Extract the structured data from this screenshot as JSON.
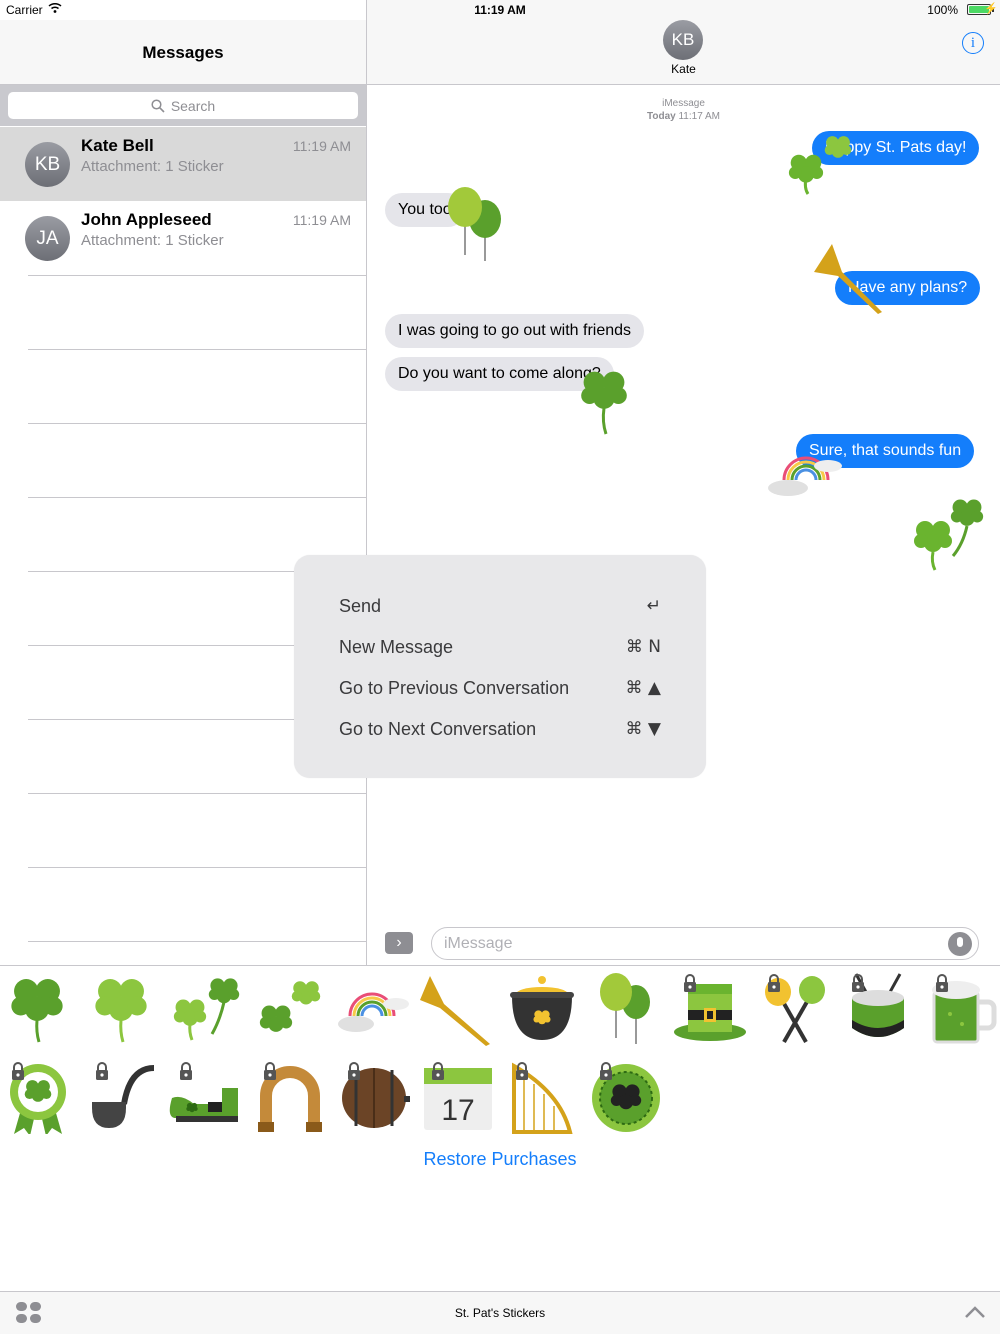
{
  "status_bar": {
    "carrier": "Carrier",
    "time": "11:19 AM",
    "battery": "100%"
  },
  "sidebar": {
    "title": "Messages",
    "search_placeholder": "Search",
    "conversations": [
      {
        "initials": "KB",
        "name": "Kate Bell",
        "preview": "Attachment: 1 Sticker",
        "time": "11:19 AM",
        "selected": true
      },
      {
        "initials": "JA",
        "name": "John Appleseed",
        "preview": "Attachment: 1 Sticker",
        "time": "11:19 AM",
        "selected": false
      }
    ]
  },
  "conversation": {
    "contact_initials": "KB",
    "contact_name": "Kate",
    "service": "iMessage",
    "day": "Today",
    "time": "11:17 AM",
    "messages": [
      {
        "direction": "out",
        "text": "Happy St. Pats day!"
      },
      {
        "direction": "in",
        "text": "You too"
      },
      {
        "direction": "out",
        "text": "Have any plans?"
      },
      {
        "direction": "in",
        "text": "I was going to go out with friends"
      },
      {
        "direction": "in",
        "text": "Do you want to come along?"
      },
      {
        "direction": "out",
        "text": "Sure, that sounds fun"
      }
    ],
    "input_placeholder": "iMessage"
  },
  "shortcuts": [
    {
      "label": "Send",
      "key": "↵"
    },
    {
      "label": "New Message",
      "key": "⌘ N"
    },
    {
      "label": "Go to Previous Conversation",
      "key": "⌘ ▲"
    },
    {
      "label": "Go to Next Conversation",
      "key": "⌘ ▼"
    }
  ],
  "sticker_pack": {
    "name": "St. Pat's Stickers",
    "restore_label": "Restore Purchases",
    "stickers": [
      {
        "icon": "shamrock-icon",
        "locked": false
      },
      {
        "icon": "light-shamrock-icon",
        "locked": false
      },
      {
        "icon": "two-shamrocks-icon",
        "locked": false
      },
      {
        "icon": "shamrock-pair-icon",
        "locked": false
      },
      {
        "icon": "rainbow-icon",
        "locked": false
      },
      {
        "icon": "horn-icon",
        "locked": false
      },
      {
        "icon": "pot-of-gold-icon",
        "locked": false
      },
      {
        "icon": "balloons-icon",
        "locked": false
      },
      {
        "icon": "leprechaun-hat-icon",
        "locked": true
      },
      {
        "icon": "maracas-icon",
        "locked": true
      },
      {
        "icon": "drum-icon",
        "locked": true
      },
      {
        "icon": "green-beer-icon",
        "locked": true
      },
      {
        "icon": "ribbon-badge-icon",
        "locked": true
      },
      {
        "icon": "pipe-icon",
        "locked": true
      },
      {
        "icon": "leprechaun-shoe-icon",
        "locked": true
      },
      {
        "icon": "horseshoe-icon",
        "locked": true
      },
      {
        "icon": "barrel-icon",
        "locked": true
      },
      {
        "icon": "calendar-icon",
        "locked": true,
        "text": "17"
      },
      {
        "icon": "harp-icon",
        "locked": true
      },
      {
        "icon": "shamrock-badge-icon",
        "locked": true
      }
    ]
  },
  "colors": {
    "accent": "#147efb",
    "shamrock": "#5aa02c",
    "light_green": "#8cc63f",
    "gold": "#d4a21a"
  }
}
